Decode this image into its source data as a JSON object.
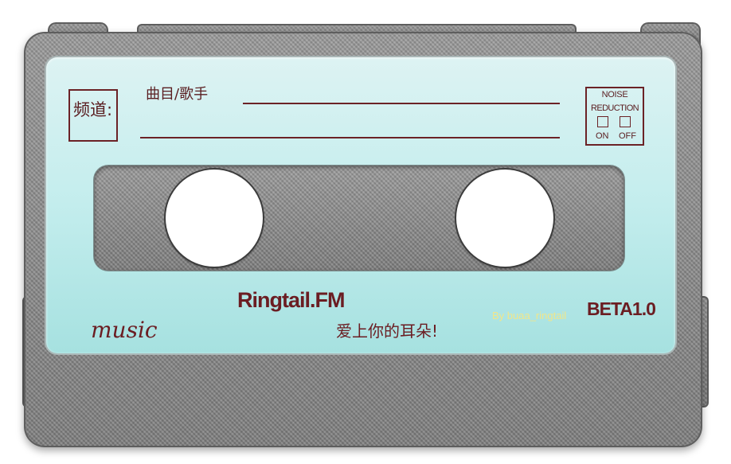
{
  "cassette": {
    "channel_label": "频道:",
    "song_artist_label": "曲目/歌手",
    "noise_reduction": {
      "title_line1": "NOISE",
      "title_line2": "REDUCTION",
      "on_label": "ON",
      "off_label": "OFF"
    },
    "brand": "Ringtail.FM",
    "slogan": "爱上你的耳朵!",
    "music_label": "music",
    "author": "By buaa_ringtail",
    "version": "BETA1.0"
  },
  "colors": {
    "label_text": "#6b1d22",
    "label_bg": "#c3eded",
    "shell": "#8a8a8a",
    "author_text": "#f1e68a"
  }
}
